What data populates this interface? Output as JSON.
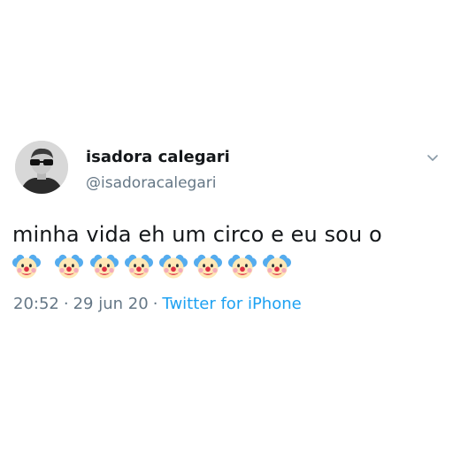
{
  "user": {
    "display_name": "isadora calegari",
    "handle": "@isadoracalegari"
  },
  "tweet": {
    "text": "minha vida eh um circo e eu sou o",
    "emoji_icon": "clown-face-icon",
    "emoji_count": 8,
    "time": "20:52",
    "date": "29 jun 20",
    "separator": "·",
    "source": "Twitter for iPhone"
  },
  "colors": {
    "text": "#14171a",
    "secondary": "#657786",
    "link": "#1da1f2"
  }
}
